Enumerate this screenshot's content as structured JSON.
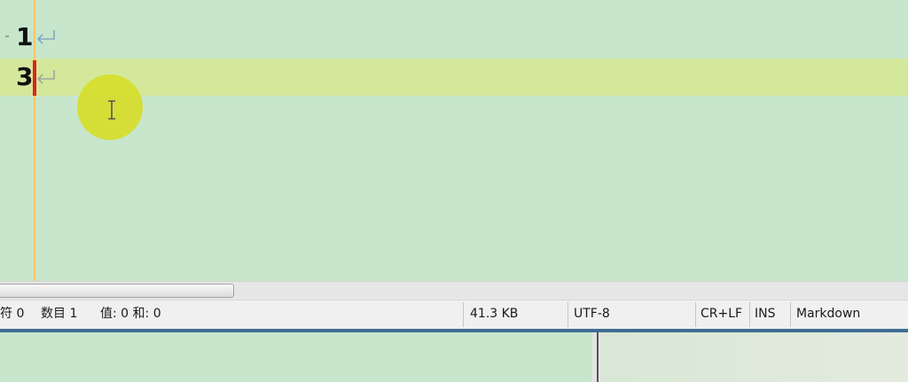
{
  "editor": {
    "lines": [
      {
        "text": "1"
      },
      {
        "text": "3"
      }
    ]
  },
  "status_bar": {
    "chars": "符 0",
    "count": "数目 1",
    "value": "值: 0 和: 0",
    "file_size": "41.3 KB",
    "encoding": "UTF-8",
    "line_ending": "CR+LF",
    "insert_mode": "INS",
    "language": "Markdown"
  },
  "colors": {
    "editor_background": "#c8e6cb",
    "current_line_highlight": "#d4e89c",
    "caret": "#e2221a",
    "margin_line": "#f2c66a",
    "pointer_halo": "#d6dd2a",
    "pane_border": "#3f6d93"
  },
  "icons": {
    "eol": "return-arrow-icon",
    "pointer": "text-cursor-icon"
  }
}
